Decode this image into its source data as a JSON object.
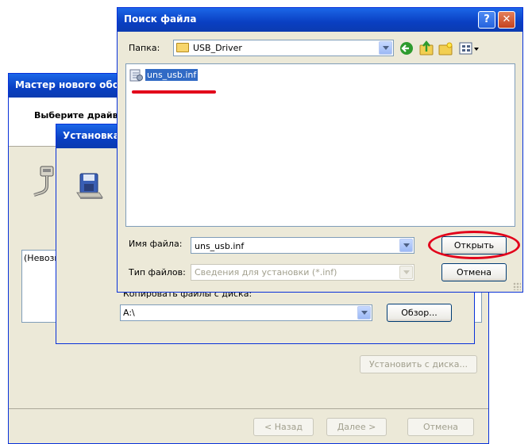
{
  "wizard": {
    "title": "Мастер нового оборудования",
    "header": "Выберите драйвер",
    "list_text": "(Невозможно",
    "have_disk_button": "Установить с диска...",
    "back_button": "< Назад",
    "next_button": "Далее >",
    "cancel_button": "Отмена"
  },
  "install_dialog": {
    "title": "Установка с диска",
    "copy_label": "Копировать файлы с диска:",
    "copy_from_value": "A:\\",
    "browse_button": "Обзор..."
  },
  "file_dialog": {
    "title": "Поиск файла",
    "folder_label": "Папка:",
    "folder_value": "USB_Driver",
    "files": [
      "uns_usb.inf"
    ],
    "filename_label": "Имя файла:",
    "filename_value": "uns_usb.inf",
    "filetype_label": "Тип файлов:",
    "filetype_value": "Сведения для установки (*.inf)",
    "open_button": "Открыть",
    "cancel_button": "Отмена",
    "help_glyph": "?",
    "close_glyph": "✕"
  },
  "colors": {
    "titlebar": "#0a3fc2",
    "selection": "#316ac5",
    "highlight": "#e2001a",
    "dialog_bg": "#ece9d8"
  },
  "icons": [
    "plug-icon",
    "floppy-disk-icon",
    "folder-icon",
    "inf-file-icon",
    "back-icon",
    "up-folder-icon",
    "new-folder-icon",
    "view-menu-icon"
  ]
}
